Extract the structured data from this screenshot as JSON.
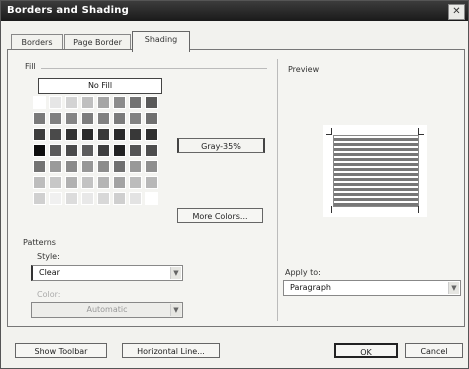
{
  "window": {
    "title": "Borders and Shading",
    "close_glyph": "✕"
  },
  "tabs": [
    {
      "label": "Borders"
    },
    {
      "label": "Page Border"
    },
    {
      "label": "Shading"
    }
  ],
  "fill": {
    "label": "Fill",
    "no_fill_label": "No Fill",
    "more_colors_label": "More Colors...",
    "selected_label": "Gray-35%",
    "colors": [
      [
        "#ffffff",
        "#e6e6e6",
        "#d3d3d3",
        "#bfbfbf",
        "#a6a6a6",
        "#8c8c8c",
        "#737373",
        "#595959"
      ],
      [
        "#7a7a7a",
        "#808080",
        "#858585",
        "#7d7d7d",
        "#818181",
        "#7b7b7b",
        "#838383",
        "#707070"
      ],
      [
        "#3d3d3d",
        "#4a4a4a",
        "#333333",
        "#2b2b2b",
        "#3a3a3a",
        "#2a2a2a",
        "#383838",
        "#303030"
      ],
      [
        "#0d0d0d",
        "#5a5a5a",
        "#4a4a4a",
        "#5c5c5c",
        "#3f3f3f",
        "#222222",
        "#545454",
        "#4d4d4d"
      ],
      [
        "#737373",
        "#9a9a9a",
        "#8a8a8a",
        "#979797",
        "#8d8d8d",
        "#707070",
        "#999999",
        "#8f8f8f"
      ],
      [
        "#bdbdbd",
        "#c7c7c7",
        "#b1b1b1",
        "#c3c3c3",
        "#b5b5b5",
        "#a3a3a3",
        "#bcbcbc",
        "#b8b8b8"
      ],
      [
        "#d0d0d0",
        "#f0f0f0",
        "#dcdcdc",
        "#e8e8e8",
        "#d8d8d8",
        "#cfcfcf",
        "#e3e3e3",
        "#ffffff"
      ]
    ]
  },
  "patterns": {
    "label": "Patterns",
    "style_label": "Style:",
    "style_value": "Clear",
    "color_label": "Color:",
    "color_value": "Automatic"
  },
  "preview": {
    "label": "Preview"
  },
  "apply_to": {
    "label": "Apply to:",
    "value": "Paragraph"
  },
  "buttons": {
    "show_toolbar": "Show Toolbar",
    "horizontal_line": "Horizontal Line...",
    "ok": "OK",
    "cancel": "Cancel"
  }
}
